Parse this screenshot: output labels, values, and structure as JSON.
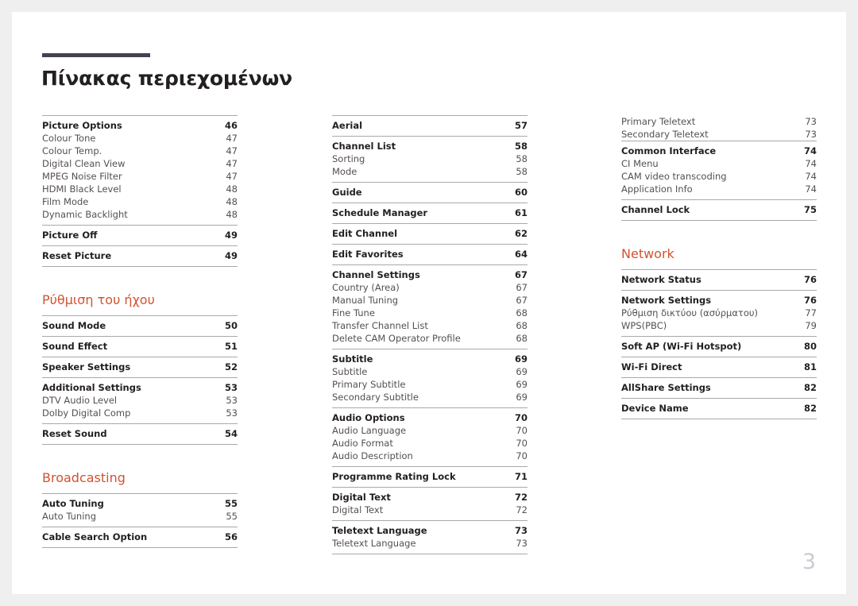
{
  "document": {
    "title": "Πίνακας περιεχομένων",
    "page_number": "3",
    "accent_color": "#d2522f",
    "rule_color": "#45424f"
  },
  "columns": [
    {
      "name": "column-left",
      "blocks": [
        {
          "type": "groups",
          "groups": [
            {
              "head": {
                "label": "Picture Options",
                "page": "46"
              },
              "subs": [
                {
                  "label": "Colour Tone",
                  "page": "47"
                },
                {
                  "label": "Colour Temp.",
                  "page": "47"
                },
                {
                  "label": "Digital Clean View",
                  "page": "47"
                },
                {
                  "label": "MPEG Noise Filter",
                  "page": "47"
                },
                {
                  "label": "HDMI Black Level",
                  "page": "48"
                },
                {
                  "label": "Film Mode",
                  "page": "48"
                },
                {
                  "label": "Dynamic Backlight",
                  "page": "48"
                }
              ]
            },
            {
              "head": {
                "label": "Picture Off",
                "page": "49"
              },
              "subs": []
            },
            {
              "head": {
                "label": "Reset Picture",
                "page": "49"
              },
              "subs": []
            }
          ]
        },
        {
          "type": "section",
          "section": "Ρύθμιση του ήχου",
          "groups": [
            {
              "head": {
                "label": "Sound Mode",
                "page": "50"
              },
              "subs": []
            },
            {
              "head": {
                "label": "Sound Effect",
                "page": "51"
              },
              "subs": []
            },
            {
              "head": {
                "label": "Speaker Settings",
                "page": "52"
              },
              "subs": []
            },
            {
              "head": {
                "label": "Additional Settings",
                "page": "53"
              },
              "subs": [
                {
                  "label": "DTV Audio Level",
                  "page": "53"
                },
                {
                  "label": "Dolby Digital Comp",
                  "page": "53"
                }
              ]
            },
            {
              "head": {
                "label": "Reset Sound",
                "page": "54"
              },
              "subs": []
            }
          ]
        },
        {
          "type": "section",
          "section": "Broadcasting",
          "groups": [
            {
              "head": {
                "label": "Auto Tuning",
                "page": "55"
              },
              "subs": [
                {
                  "label": "Auto Tuning",
                  "page": "55"
                }
              ]
            },
            {
              "head": {
                "label": "Cable Search Option",
                "page": "56"
              },
              "subs": []
            }
          ]
        }
      ]
    },
    {
      "name": "column-middle",
      "blocks": [
        {
          "type": "groups",
          "groups": [
            {
              "head": {
                "label": "Aerial",
                "page": "57"
              },
              "subs": []
            },
            {
              "head": {
                "label": "Channel List",
                "page": "58"
              },
              "subs": [
                {
                  "label": "Sorting",
                  "page": "58"
                },
                {
                  "label": "Mode",
                  "page": "58"
                }
              ]
            },
            {
              "head": {
                "label": "Guide",
                "page": "60"
              },
              "subs": []
            },
            {
              "head": {
                "label": "Schedule Manager",
                "page": "61"
              },
              "subs": []
            },
            {
              "head": {
                "label": "Edit Channel",
                "page": "62"
              },
              "subs": []
            },
            {
              "head": {
                "label": "Edit Favorites",
                "page": "64"
              },
              "subs": []
            },
            {
              "head": {
                "label": "Channel Settings",
                "page": "67"
              },
              "subs": [
                {
                  "label": "Country (Area)",
                  "page": "67"
                },
                {
                  "label": "Manual Tuning",
                  "page": "67"
                },
                {
                  "label": "Fine Tune",
                  "page": "68"
                },
                {
                  "label": "Transfer Channel List",
                  "page": "68"
                },
                {
                  "label": "Delete CAM Operator Profile",
                  "page": "68"
                }
              ]
            },
            {
              "head": {
                "label": "Subtitle",
                "page": "69"
              },
              "subs": [
                {
                  "label": "Subtitle",
                  "page": "69"
                },
                {
                  "label": "Primary Subtitle",
                  "page": "69"
                },
                {
                  "label": "Secondary Subtitle",
                  "page": "69"
                }
              ]
            },
            {
              "head": {
                "label": "Audio Options",
                "page": "70"
              },
              "subs": [
                {
                  "label": "Audio Language",
                  "page": "70"
                },
                {
                  "label": "Audio Format",
                  "page": "70"
                },
                {
                  "label": "Audio Description",
                  "page": "70"
                }
              ]
            },
            {
              "head": {
                "label": "Programme Rating Lock",
                "page": "71"
              },
              "subs": []
            },
            {
              "head": {
                "label": "Digital Text",
                "page": "72"
              },
              "subs": [
                {
                  "label": "Digital Text",
                  "page": "72"
                }
              ]
            },
            {
              "head": {
                "label": "Teletext Language",
                "page": "73"
              },
              "subs": [
                {
                  "label": "Teletext Language",
                  "page": "73"
                }
              ]
            }
          ]
        }
      ]
    },
    {
      "name": "column-right",
      "blocks": [
        {
          "type": "orphan",
          "rows": [
            {
              "label": "Primary Teletext",
              "page": "73"
            },
            {
              "label": "Secondary Teletext",
              "page": "73"
            }
          ]
        },
        {
          "type": "groups",
          "groups": [
            {
              "head": {
                "label": "Common Interface",
                "page": "74"
              },
              "subs": [
                {
                  "label": "CI Menu",
                  "page": "74"
                },
                {
                  "label": "CAM video transcoding",
                  "page": "74"
                },
                {
                  "label": "Application Info",
                  "page": "74"
                }
              ]
            },
            {
              "head": {
                "label": "Channel Lock",
                "page": "75"
              },
              "subs": []
            }
          ]
        },
        {
          "type": "section",
          "section": "Network",
          "groups": [
            {
              "head": {
                "label": "Network Status",
                "page": "76"
              },
              "subs": []
            },
            {
              "head": {
                "label": "Network Settings",
                "page": "76"
              },
              "subs": [
                {
                  "label": "Ρύθμιση δικτύου (ασύρματου)",
                  "page": "77"
                },
                {
                  "label": "WPS(PBC)",
                  "page": "79"
                }
              ]
            },
            {
              "head": {
                "label": "Soft AP (Wi-Fi Hotspot)",
                "page": "80"
              },
              "subs": []
            },
            {
              "head": {
                "label": "Wi-Fi Direct",
                "page": "81"
              },
              "subs": []
            },
            {
              "head": {
                "label": "AllShare Settings",
                "page": "82"
              },
              "subs": []
            },
            {
              "head": {
                "label": "Device Name",
                "page": "82"
              },
              "subs": []
            }
          ]
        }
      ]
    }
  ]
}
